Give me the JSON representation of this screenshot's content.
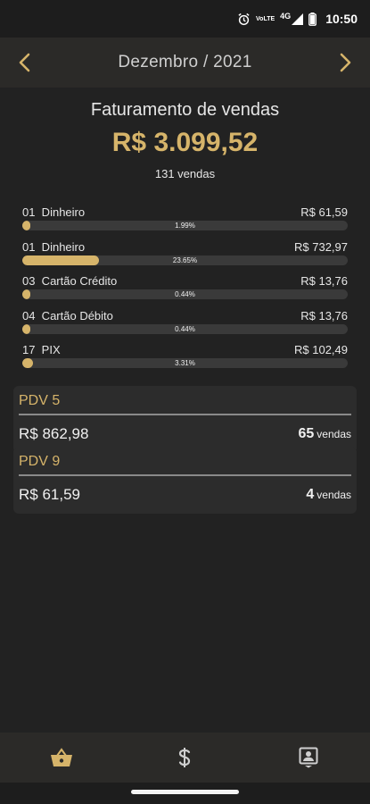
{
  "status_bar": {
    "time": "10:50",
    "network_top": "VoLTE",
    "network": "4G",
    "icons": [
      "alarm-icon",
      "volte-icon",
      "signal-4g-icon",
      "battery-icon"
    ]
  },
  "header": {
    "month_label": "Dezembro / 2021",
    "prev_icon": "chevron-left-icon",
    "next_icon": "chevron-right-icon"
  },
  "summary": {
    "title": "Faturamento de vendas",
    "total": "R$ 3.099,52",
    "count_text": "131 vendas"
  },
  "payments": [
    {
      "label": "01  Dinheiro",
      "value": "R$ 61,59",
      "percent_text": "1.99%",
      "percent": 1.99
    },
    {
      "label": "01  Dinheiro",
      "value": "R$ 732,97",
      "percent_text": "23.65%",
      "percent": 23.65
    },
    {
      "label": "03  Cartão Crédito",
      "value": "R$ 13,76",
      "percent_text": "0.44%",
      "percent": 0.44
    },
    {
      "label": "04  Cartão Débito",
      "value": "R$ 13,76",
      "percent_text": "0.44%",
      "percent": 0.44
    },
    {
      "label": "17  PIX",
      "value": "R$ 102,49",
      "percent_text": "3.31%",
      "percent": 3.31
    }
  ],
  "pdvs": [
    {
      "name": "PDV 5",
      "value": "R$ 862,98",
      "count": "65",
      "unit": "vendas"
    },
    {
      "name": "PDV 9",
      "value": "R$ 61,59",
      "count": "4",
      "unit": "vendas"
    }
  ],
  "bottom_nav": [
    {
      "name": "basket-icon",
      "active": true
    },
    {
      "name": "dollar-icon",
      "active": false
    },
    {
      "name": "id-badge-icon",
      "active": false
    }
  ],
  "colors": {
    "accent": "#d6b46a",
    "background": "#222222",
    "bar_track": "#3a3a3a",
    "card": "#2c2c2c",
    "header": "#2b2a28"
  }
}
